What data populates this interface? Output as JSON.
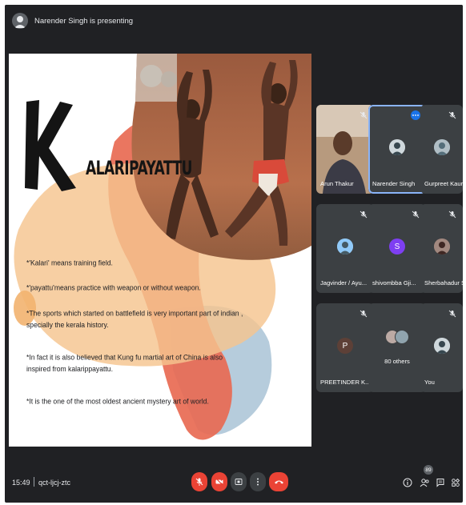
{
  "presenter": {
    "text": "Narender Singh is presenting"
  },
  "slide": {
    "title_k": "K",
    "title_rest": "ALARIPAYATTU",
    "bullets": [
      "*'Kalari' means training field.",
      "*'payattu'means practice with weapon or without weapon.",
      "*The sports which started on battlefield is very important part of indian , specially the kerala history.",
      "*In fact it is also believed that Kung fu martial art of China is also inspired from kalarippayattu.",
      "*It is the one of the most oldest ancient mystery art of world."
    ]
  },
  "participants": [
    {
      "name": "Arun Thakur",
      "kind": "video",
      "muted": true
    },
    {
      "name": "Narender Singh",
      "kind": "photo",
      "active": true
    },
    {
      "name": "Gurpreet Kaur",
      "kind": "photo",
      "muted": true
    },
    {
      "name": "Jagvinder / Ayu...",
      "kind": "photo",
      "muted": true
    },
    {
      "name": "shivombba Gji...",
      "kind": "letter",
      "letter": "S",
      "color": "#7e3ff2",
      "muted": true
    },
    {
      "name": "Sherbahadur S...",
      "kind": "photo",
      "muted": true
    },
    {
      "name": "PREETINDER K...",
      "kind": "letter",
      "letter": "P",
      "color": "#5d4037",
      "muted": true
    },
    {
      "name": "80 others",
      "kind": "group"
    },
    {
      "name": "You",
      "kind": "photo",
      "muted": true
    }
  ],
  "bottom_bar": {
    "time": "15:49",
    "meeting_code": "qct-ljcj-ztc",
    "people_count": "89"
  },
  "colors": {
    "background": "#202124",
    "tile": "#3c4043",
    "end_call": "#ea4335",
    "active_border": "#8ab4f8"
  }
}
